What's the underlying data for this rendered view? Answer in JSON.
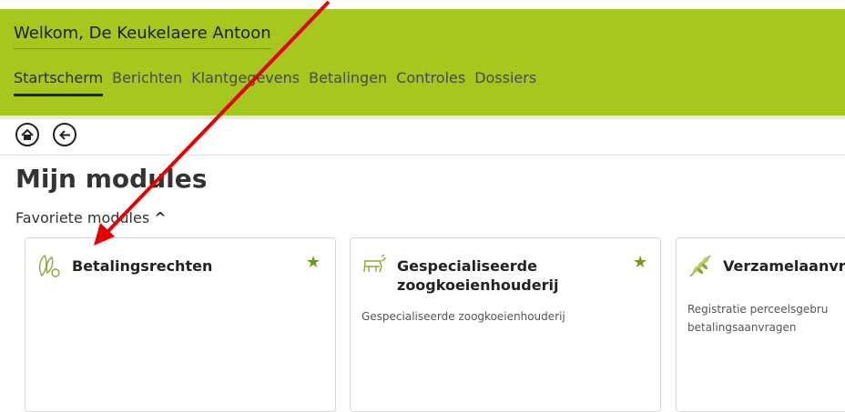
{
  "header": {
    "welcome": "Welkom, De Keukelaere Antoon",
    "nav": [
      {
        "label": "Startscherm",
        "active": true
      },
      {
        "label": "Berichten"
      },
      {
        "label": "Klantgegevens"
      },
      {
        "label": "Betalingen"
      },
      {
        "label": "Controles"
      },
      {
        "label": "Dossiers"
      }
    ],
    "accent": "#a6c81e"
  },
  "toolbar": {
    "home_icon": "home-icon",
    "back_icon": "back-arrow-icon"
  },
  "main": {
    "title": "Mijn modules",
    "favorites_label": "Favoriete modules",
    "favorites_toggle": "^",
    "cards": [
      {
        "title": "Betalingsrechten",
        "desc": "",
        "icon": "seed-icon",
        "favorite": true
      },
      {
        "title_line1": "Gespecialiseerde",
        "title_line2": "zoogkoeienhouderij",
        "desc": "Gespecialiseerde zoogkoeienhouderij",
        "icon": "cow-icon",
        "favorite": true
      },
      {
        "title": "Verzamelaanvra",
        "desc_line1": "Registratie perceelsgebru",
        "desc_line2": "betalingsaanvragen",
        "icon": "wheat-icon"
      }
    ]
  },
  "annotation": {
    "color": "#e60000"
  }
}
